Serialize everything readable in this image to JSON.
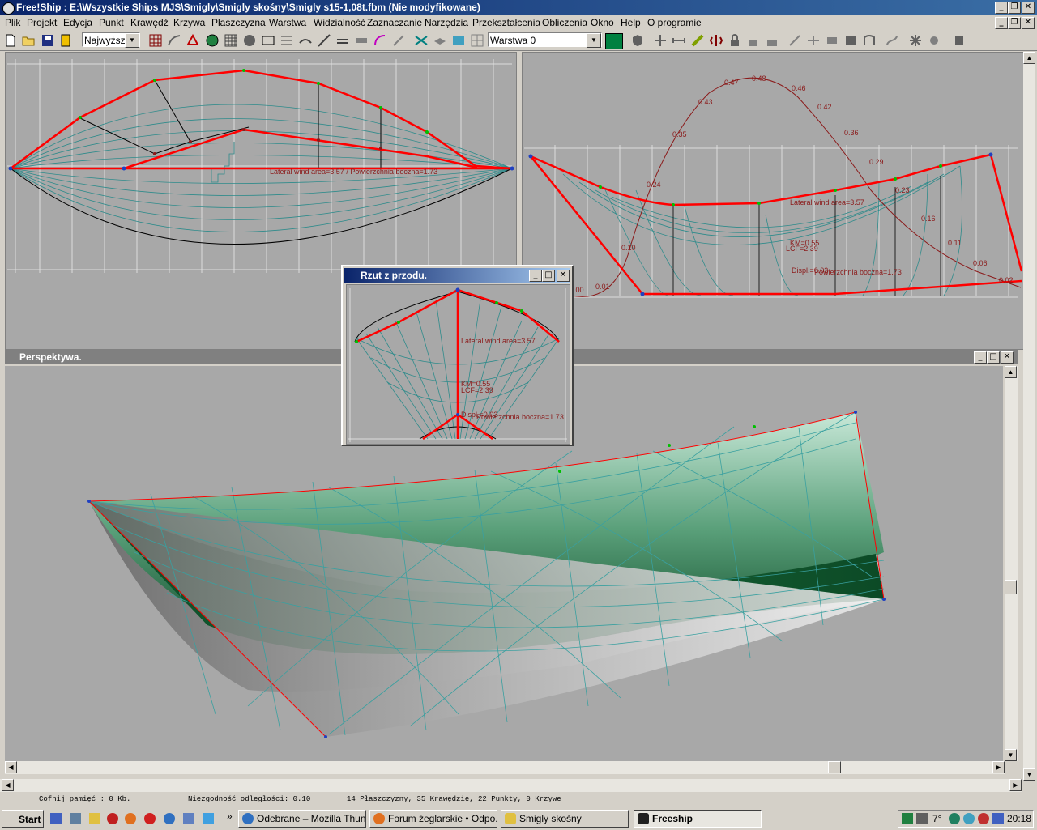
{
  "window": {
    "title": "Free!Ship : E:\\Wszystkie Ships MJS\\Smigly\\Smigly skośny\\Smigly s15-1,08t.fbm (Nie modyfikowane)"
  },
  "menu": [
    "Plik",
    "Projekt",
    "Edycja",
    "Punkt",
    "Krawędź",
    "Krzywa",
    "Płaszczyzna",
    "Warstwa",
    "Widzialność",
    "Zaznaczanie",
    "Narzędzia",
    "Przekształcenia",
    "Obliczenia",
    "Okno",
    "Help",
    "O programie"
  ],
  "toolbar": {
    "precision_value": "Najwyższy",
    "layer_value": "Warstwa 0",
    "layer_color": "#008040"
  },
  "views": {
    "plan": {
      "label_text": "Lateral wind area=3.57 / Powierzchnia boczna=1.73"
    },
    "profile": {
      "labels": {
        "lateral_wind": "Lateral wind area=3.57",
        "km": "KM=0.55",
        "lcf": "LCF=2.39",
        "displ": "Displ.=0.03",
        "side_area": "Powierzchnia boczna=1.73"
      },
      "curve_values": [
        "0.00",
        "0.01",
        "0.10",
        "0.24",
        "0.35",
        "0.43",
        "0.47",
        "0.48",
        "0.46",
        "0.42",
        "0.36",
        "0.29",
        "0.23",
        "0.16",
        "0.11",
        "0.06",
        "0.02"
      ]
    },
    "front": {
      "title": "Rzut z przodu.",
      "labels": {
        "lateral_wind": "Lateral wind area=3.57",
        "km": "KM=0.55",
        "lcf": "LCF=2.39",
        "displ": "Displ.=0.03",
        "side_area": "Powierzchnia boczna=1.73"
      }
    },
    "perspective": {
      "title": "Perspektywa."
    }
  },
  "status": {
    "undo_memory": "Cofnij pamięć : 0 Kb.",
    "tolerance": "Niezgodność odległości: 0.10",
    "counts": "14 Płaszczyzny, 35 Krawędzie, 22 Punkty, 0 Krzywe"
  },
  "taskbar": {
    "start": "Start",
    "tasks": [
      {
        "label": "Odebrane – Mozilla Thun..."
      },
      {
        "label": "Forum żeglarskie • Odpo..."
      },
      {
        "label": "Smigly skośny"
      },
      {
        "label": "Freeship"
      }
    ],
    "temperature": "7°",
    "clock": "20:18"
  },
  "colors": {
    "title_active": "#0a246a",
    "hull_green": "#1a6a3a",
    "edge_red": "#ff0000",
    "grid_line": "#2e8b8b"
  }
}
